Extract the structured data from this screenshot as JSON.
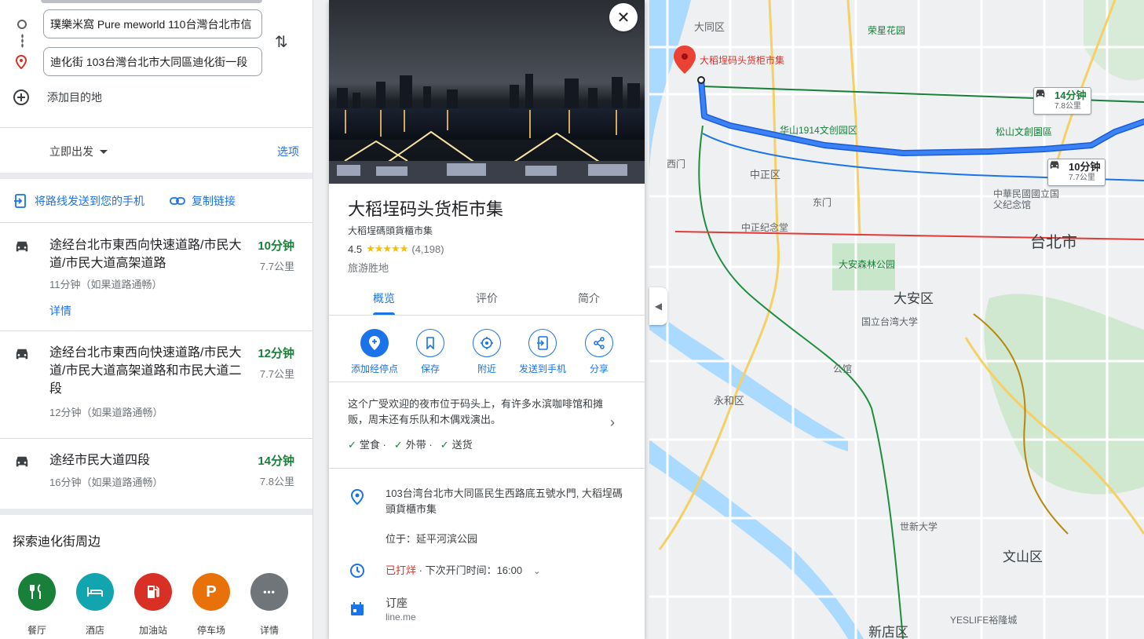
{
  "directions": {
    "origin": "璞樂米窩 Pure meworld 110台灣台北市信",
    "destination": "迪化街 103台灣台北市大同區迪化街一段",
    "add_destination": "添加目的地",
    "depart_now": "立即出发",
    "options": "选项",
    "send_to_phone": "将路线发送到您的手机",
    "copy_link": "复制链接"
  },
  "routes": [
    {
      "title": "途经台北市東西向快速道路/市民大道/市民大道高架道路",
      "subtitle": "11分钟（如果道路通畅）",
      "time": "10分钟",
      "distance": "7.7公里",
      "details": "详情"
    },
    {
      "title": "途经台北市東西向快速道路/市民大道/市民大道高架道路和市民大道二段",
      "subtitle": "12分钟（如果道路通畅）",
      "time": "12分钟",
      "distance": "7.7公里"
    },
    {
      "title": "途经市民大道四段",
      "subtitle": "16分钟（如果道路通畅）",
      "time": "14分钟",
      "distance": "7.8公里"
    }
  ],
  "explore": {
    "title": "探索迪化街周边",
    "items": [
      {
        "label": "餐厅",
        "icon": "restaurant-icon",
        "color": "#188038"
      },
      {
        "label": "酒店",
        "icon": "hotel-icon",
        "color": "#12a4af"
      },
      {
        "label": "加油站",
        "icon": "gas-station-icon",
        "color": "#d93025"
      },
      {
        "label": "停车场",
        "icon": "parking-icon",
        "color": "#e8710a",
        "glyph": "P"
      },
      {
        "label": "详情",
        "icon": "more-icon",
        "color": "#70757a",
        "glyph": "•••"
      }
    ]
  },
  "place": {
    "name": "大稻埕码头货柜市集",
    "alt_name": "大稻埕碼頭貨櫃市集",
    "rating": "4.5",
    "stars": "★★★★★",
    "reviews": "(4,198)",
    "category": "旅游胜地",
    "tabs": [
      "概览",
      "评价",
      "简介"
    ],
    "actions": [
      {
        "label": "添加经停点",
        "icon": "add-stop-icon"
      },
      {
        "label": "保存",
        "icon": "bookmark-icon"
      },
      {
        "label": "附近",
        "icon": "nearby-icon"
      },
      {
        "label": "发送到手机",
        "icon": "send-to-phone-icon"
      },
      {
        "label": "分享",
        "icon": "share-icon"
      }
    ],
    "description": "这个广受欢迎的夜市位于码头上，有许多水滨咖啡馆和摊贩，周末还有乐队和木偶戏演出。",
    "amenities": [
      "堂食",
      "外带",
      "送货"
    ],
    "address": "103台湾台北市大同區民生西路底五號水門, 大稻埕碼頭貨櫃市集",
    "located_in": "位于：延平河滨公园",
    "hours_status": "已打烊",
    "hours_next": " · 下次开门时间：16:00",
    "reserve": "订座",
    "reserve_site": "line.me"
  },
  "map": {
    "destination_label": "大稻埕码头货柜市集",
    "labels": {
      "datong": "大同区",
      "zhongzheng": "中正区",
      "daan": "大安区",
      "taipei": "台北市",
      "yonghe": "永和区",
      "wenshan": "文山区",
      "xindian": "新店区",
      "huashan": "华山1914文创园区",
      "songshan": "松山文創園區",
      "cks": "中正纪念堂",
      "sunyatsen": "中華民國國立国父纪念馆",
      "daan_park": "大安森林公园",
      "ntu": "国立台湾大学",
      "rongxing": "荣星花园",
      "ximen": "西门",
      "dongmen": "东门",
      "gongguan": "公馆",
      "xinhai": "世新大学",
      "yesi": "YESLIFE裕隆城"
    },
    "duration_selected": {
      "time": "10分钟",
      "distance": "7.7公里"
    },
    "duration_alt": {
      "time": "14分钟",
      "distance": "7.8公里"
    }
  },
  "colors": {
    "accent": "#1a73e8",
    "route_fast": "#188038",
    "closed": "#d93025"
  }
}
